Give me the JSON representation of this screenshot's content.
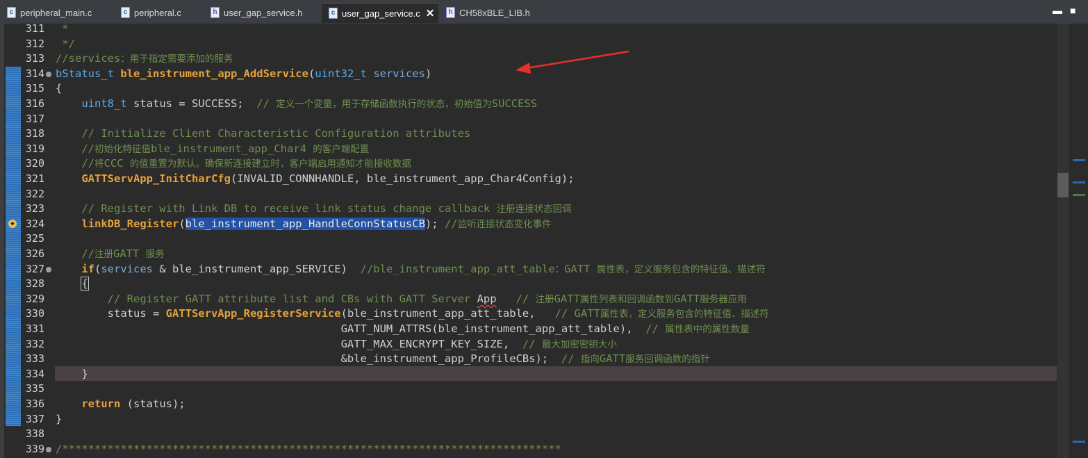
{
  "tabs": [
    {
      "label": "peripheral_main.c",
      "icon": "c-file-icon",
      "active": false
    },
    {
      "label": "peripheral.c",
      "icon": "c-file-icon",
      "active": false
    },
    {
      "label": "user_gap_service.h",
      "icon": "h-file-icon",
      "active": false
    },
    {
      "label": "user_gap_service.c",
      "icon": "c-file-icon",
      "active": true
    },
    {
      "label": "CH58xBLE_LIB.h",
      "icon": "h-file-icon",
      "active": false
    }
  ],
  "window_controls": {
    "minimize": "▬",
    "maximize": "■"
  },
  "tab_close_glyph": "✕",
  "colors": {
    "background": "#2b2b2b",
    "comment": "#6f8f4e",
    "keyword": "#e5a23b",
    "type": "#5aa9e6",
    "selection": "#2252a8",
    "current_line": "#4a4242",
    "annotation_arrow": "#e8302a"
  },
  "lines": [
    {
      "n": "311",
      "t": [
        [
          " *",
          "c"
        ]
      ]
    },
    {
      "n": "312",
      "t": [
        [
          " */",
          "c"
        ]
      ]
    },
    {
      "n": "313",
      "t": [
        [
          "//services",
          "c"
        ],
        [
          "：用于指定需要添加的服务",
          "cn"
        ]
      ]
    },
    {
      "n": "314",
      "fold": true,
      "t": [
        [
          "bStatus_t",
          "ty"
        ],
        [
          " ",
          ""
        ],
        [
          "ble_instrument_app_AddService",
          "fn"
        ],
        [
          "(",
          ""
        ],
        [
          "uint32_t",
          "ty"
        ],
        [
          " ",
          ""
        ],
        [
          "services",
          "p"
        ],
        [
          ")",
          ""
        ]
      ]
    },
    {
      "n": "315",
      "t": [
        [
          "{",
          ""
        ]
      ]
    },
    {
      "n": "316",
      "t": [
        [
          "    ",
          ""
        ],
        [
          "uint8_t",
          "ty"
        ],
        [
          " status = SUCCESS;  ",
          ""
        ],
        [
          "// ",
          "c"
        ],
        [
          "定义一个变量，用于存储函数执行的状态，初始值为",
          "cn"
        ],
        [
          "SUCCESS",
          "c"
        ]
      ]
    },
    {
      "n": "317",
      "t": []
    },
    {
      "n": "318",
      "t": [
        [
          "    ",
          ""
        ],
        [
          "// Initialize Client Characteristic Configuration attributes",
          "c"
        ]
      ]
    },
    {
      "n": "319",
      "t": [
        [
          "    ",
          ""
        ],
        [
          "//",
          "c"
        ],
        [
          "初始化特征值",
          "cn"
        ],
        [
          "ble_instrument_app_Char4 ",
          "c"
        ],
        [
          "的客户端配置",
          "cn"
        ]
      ]
    },
    {
      "n": "320",
      "t": [
        [
          "    ",
          ""
        ],
        [
          "//",
          "c"
        ],
        [
          "将",
          "cn"
        ],
        [
          "CCC ",
          "c"
        ],
        [
          "的值重置为默认。确保新连接建立时，客户端启用通知才能接收数据",
          "cn"
        ]
      ]
    },
    {
      "n": "321",
      "t": [
        [
          "    ",
          ""
        ],
        [
          "GATTServApp_InitCharCfg",
          "fn"
        ],
        [
          "(INVALID_CONNHANDLE, ble_instrument_app_Char4Config);",
          ""
        ]
      ]
    },
    {
      "n": "322",
      "t": []
    },
    {
      "n": "323",
      "t": [
        [
          "    ",
          ""
        ],
        [
          "// Register with Link DB to receive link status change callback ",
          "c"
        ],
        [
          "注册连接状态回调",
          "cn"
        ]
      ]
    },
    {
      "n": "324",
      "bp": true,
      "t": [
        [
          "    ",
          ""
        ],
        [
          "linkDB_Register",
          "fn"
        ],
        [
          "(",
          ""
        ],
        [
          "ble_instrument_app_HandleConnStatusCB",
          "sel"
        ],
        [
          "); ",
          ""
        ],
        [
          "//",
          "c"
        ],
        [
          "监听连接状态变化事件",
          "cn"
        ]
      ]
    },
    {
      "n": "325",
      "t": []
    },
    {
      "n": "326",
      "t": [
        [
          "    ",
          ""
        ],
        [
          "//",
          "c"
        ],
        [
          "注册",
          "cn"
        ],
        [
          "GATT ",
          "c"
        ],
        [
          "服务",
          "cn"
        ]
      ]
    },
    {
      "n": "327",
      "fold": true,
      "t": [
        [
          "    ",
          ""
        ],
        [
          "if",
          "kw"
        ],
        [
          "(",
          ""
        ],
        [
          "services",
          "p"
        ],
        [
          " & ble_instrument_app_SERVICE)  ",
          ""
        ],
        [
          "//ble_instrument_app_att_table",
          "c"
        ],
        [
          "：",
          "cn"
        ],
        [
          "GATT ",
          "c"
        ],
        [
          "属性表，定义服务包含的特征值、描述符",
          "cn"
        ]
      ]
    },
    {
      "n": "328",
      "t": [
        [
          "    ",
          ""
        ],
        [
          "{",
          "br"
        ]
      ]
    },
    {
      "n": "329",
      "t": [
        [
          "        ",
          ""
        ],
        [
          "// Register GATT attribute list and CBs with GATT Server ",
          "c"
        ],
        [
          "App",
          "sq"
        ],
        [
          "   // ",
          "c"
        ],
        [
          "注册",
          "cn"
        ],
        [
          "GATT",
          "c"
        ],
        [
          "属性列表和回调函数到",
          "cn"
        ],
        [
          "GATT",
          "c"
        ],
        [
          "服务器应用",
          "cn"
        ]
      ]
    },
    {
      "n": "330",
      "t": [
        [
          "        status = ",
          ""
        ],
        [
          "GATTServApp_RegisterService",
          "fn"
        ],
        [
          "(ble_instrument_app_att_table,   ",
          ""
        ],
        [
          "// GATT",
          "c"
        ],
        [
          "属性表，定义服务包含的特征值、描述符",
          "cn"
        ]
      ]
    },
    {
      "n": "331",
      "t": [
        [
          "                                            GATT_NUM_ATTRS(ble_instrument_app_att_table),  ",
          ""
        ],
        [
          "// ",
          "c"
        ],
        [
          "属性表中的属性数量",
          "cn"
        ]
      ]
    },
    {
      "n": "332",
      "t": [
        [
          "                                            GATT_MAX_ENCRYPT_KEY_SIZE,  ",
          ""
        ],
        [
          "// ",
          "c"
        ],
        [
          "最大加密密钥大小",
          "cn"
        ]
      ]
    },
    {
      "n": "333",
      "t": [
        [
          "                                            &ble_instrument_app_ProfileCBs);  ",
          ""
        ],
        [
          "// ",
          "c"
        ],
        [
          "指向",
          "cn"
        ],
        [
          "GATT",
          "c"
        ],
        [
          "服务回调函数的指针",
          "cn"
        ]
      ]
    },
    {
      "n": "334",
      "t": [
        [
          "    }",
          ""
        ]
      ]
    },
    {
      "n": "335",
      "t": []
    },
    {
      "n": "336",
      "t": [
        [
          "    ",
          ""
        ],
        [
          "return",
          "kw"
        ],
        [
          " (status);",
          ""
        ]
      ]
    },
    {
      "n": "337",
      "t": [
        [
          "}",
          ""
        ]
      ]
    },
    {
      "n": "338",
      "t": []
    },
    {
      "n": "339",
      "fold": true,
      "t": [
        [
          "/*****************************************************************************",
          "c"
        ]
      ]
    }
  ]
}
